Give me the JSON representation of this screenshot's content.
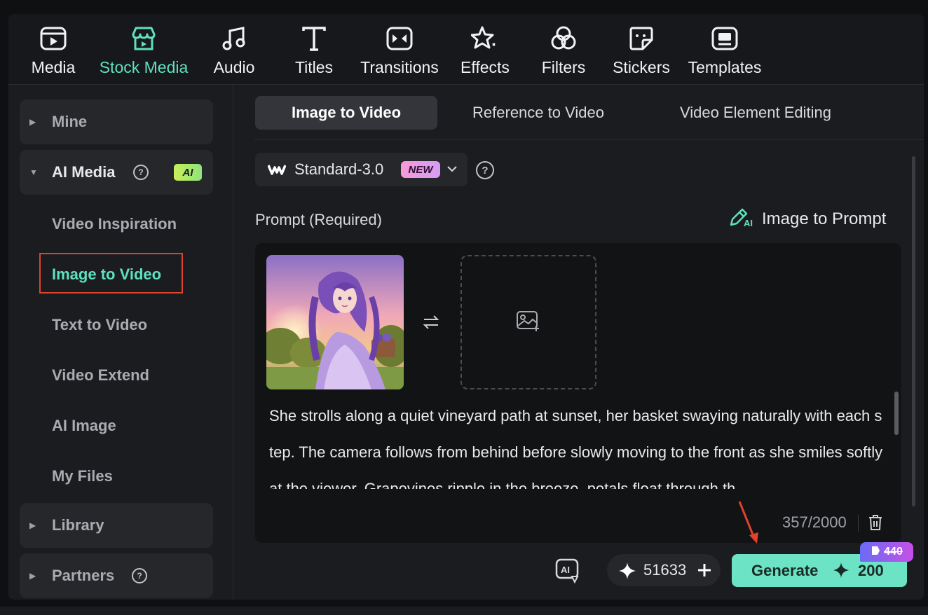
{
  "toolbar": {
    "items": [
      {
        "label": "Media",
        "icon": "media-icon"
      },
      {
        "label": "Stock Media",
        "icon": "stock-media-icon"
      },
      {
        "label": "Audio",
        "icon": "music-note-icon"
      },
      {
        "label": "Titles",
        "icon": "text-icon"
      },
      {
        "label": "Transitions",
        "icon": "transitions-icon"
      },
      {
        "label": "Effects",
        "icon": "sparkle-effects-icon"
      },
      {
        "label": "Filters",
        "icon": "filters-icon"
      },
      {
        "label": "Stickers",
        "icon": "sticker-icon"
      },
      {
        "label": "Templates",
        "icon": "templates-icon"
      }
    ],
    "active": "Stock Media",
    "active_color": "#5fe0c0"
  },
  "sidebar": {
    "mine": "Mine",
    "ai_media": "AI Media",
    "ai_badge": "AI",
    "items": [
      {
        "label": "Video Inspiration"
      },
      {
        "label": "Image to Video"
      },
      {
        "label": "Text to Video"
      },
      {
        "label": "Video Extend"
      },
      {
        "label": "AI Image"
      },
      {
        "label": "My Files"
      }
    ],
    "active_item": "Image to Video",
    "library": "Library",
    "partners": "Partners"
  },
  "main": {
    "tabs": [
      {
        "label": "Image to Video"
      },
      {
        "label": "Reference to Video"
      },
      {
        "label": "Video Element Editing"
      }
    ],
    "active_tab": "Image to Video",
    "model": {
      "name": "Standard-3.0",
      "badge": "NEW"
    },
    "prompt_label": "Prompt (Required)",
    "image_to_prompt": "Image to Prompt",
    "prompt_text": "She strolls along a quiet vineyard path at sunset, her basket swaying naturally with each step. The camera follows from behind before slowly moving to the front as she smiles softly at the viewer. Grapevines ripple in the breeze, petals float through th",
    "char_count": "357/2000",
    "credits": "51633",
    "generate_label": "Generate",
    "generate_cost": "200",
    "original_price": "440"
  },
  "colors": {
    "accent": "#5fe0c0",
    "generate_bg": "#6be3c4",
    "highlight_box": "#e0432d",
    "annotation_arrow": "#e0432d"
  }
}
